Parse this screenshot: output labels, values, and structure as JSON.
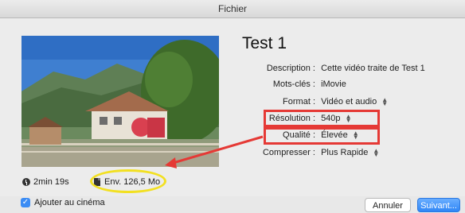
{
  "window": {
    "title": "Fichier"
  },
  "video": {
    "title": "Test 1",
    "duration": "2min 19s",
    "size": "Env. 126,5 Mo"
  },
  "fields": {
    "description": {
      "label": "Description :",
      "value": "Cette vidéo traite de Test 1"
    },
    "keywords": {
      "label": "Mots-clés :",
      "value": "iMovie"
    },
    "format": {
      "label": "Format :",
      "value": "Vidéo et audio"
    },
    "resolution": {
      "label": "Résolution :",
      "value": "540p"
    },
    "quality": {
      "label": "Qualité :",
      "value": "Élevée"
    },
    "compress": {
      "label": "Compresser :",
      "value": "Plus Rapide"
    }
  },
  "options": {
    "add_to_cinema": "Ajouter au cinéma",
    "add_to_cinema_checked": true
  },
  "buttons": {
    "cancel": "Annuler",
    "next": "Suivant..."
  },
  "annotations": {
    "highlight_color": "#e53935",
    "ellipse_color": "#f2e021"
  }
}
